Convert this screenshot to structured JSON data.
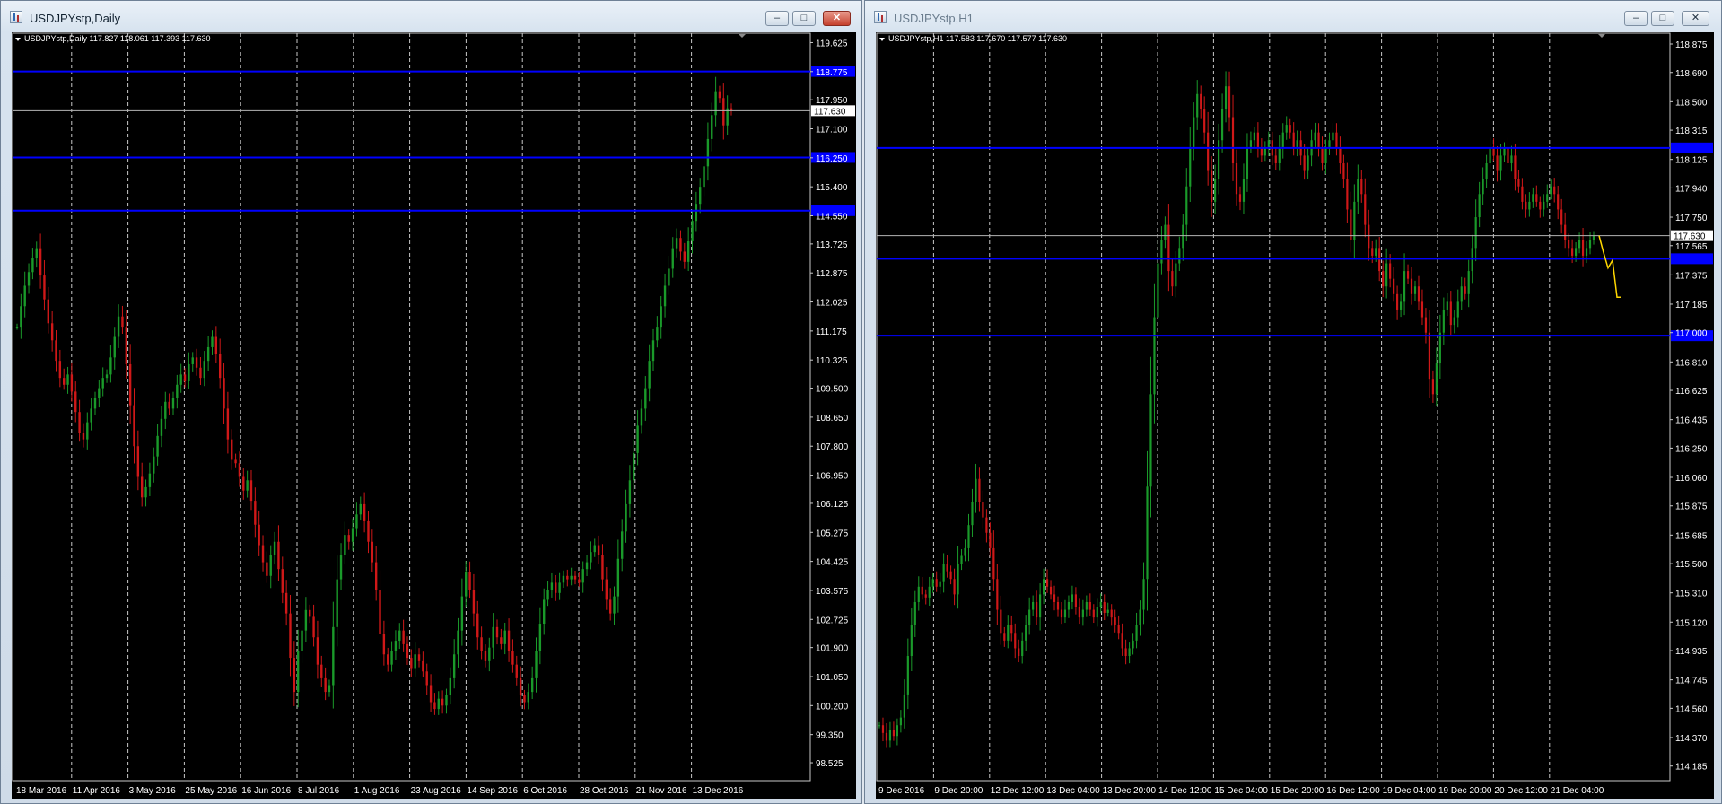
{
  "windows": [
    {
      "title": "USDJPYstp,Daily",
      "header": "USDJPYstp,Daily  117.827 118.061 117.393 117.630",
      "buttons": {
        "minimize": "–",
        "maximize": "□",
        "close": "✕"
      }
    },
    {
      "title": "USDJPYstp,H1",
      "header": "USDJPYstp,H1  117.583 117.670 117.577 117.630",
      "buttons": {
        "minimize": "–",
        "maximize": "□",
        "close": "✕"
      }
    }
  ],
  "colors": {
    "background": "#000000",
    "grid": "#c8c8c8",
    "bull": "#1a9a2a",
    "bear": "#d01818",
    "level_line": "#0000ff",
    "price_line": "#b4b4b4",
    "projection": "#ffd700"
  },
  "chart_data": [
    {
      "type": "candlestick",
      "symbol": "USDJPYstp",
      "timeframe": "Daily",
      "ohlc_last": {
        "open": 117.827,
        "high": 118.061,
        "low": 117.393,
        "close": 117.63
      },
      "ylim": [
        98.0,
        119.9
      ],
      "yticks": [
        119.625,
        118.775,
        117.95,
        117.1,
        116.25,
        115.4,
        114.55,
        113.725,
        112.875,
        112.025,
        111.175,
        110.325,
        109.5,
        108.65,
        107.8,
        106.95,
        106.125,
        105.275,
        104.425,
        103.575,
        102.725,
        101.9,
        101.05,
        100.2,
        99.35,
        98.525
      ],
      "xticks": [
        "18 Mar 2016",
        "11 Apr 2016",
        "3 May 2016",
        "25 May 2016",
        "16 Jun 2016",
        "8 Jul 2016",
        "1 Aug 2016",
        "23 Aug 2016",
        "14 Sep 2016",
        "6 Oct 2016",
        "28 Oct 2016",
        "21 Nov 2016",
        "13 Dec 2016"
      ],
      "current_price": "117.630",
      "levels": [
        118.78,
        116.26,
        114.7
      ],
      "grid": true,
      "closes": [
        111.3,
        111.9,
        112.5,
        112.9,
        113.3,
        113.6,
        112.8,
        112.1,
        111.4,
        110.9,
        110.3,
        109.8,
        109.6,
        109.9,
        109.4,
        108.8,
        108.2,
        108.0,
        108.5,
        108.9,
        109.2,
        109.5,
        109.8,
        109.9,
        110.4,
        111.0,
        111.6,
        111.3,
        110.2,
        109.0,
        107.8,
        106.9,
        106.3,
        106.6,
        107.0,
        107.5,
        108.1,
        108.6,
        109.1,
        108.9,
        109.2,
        109.6,
        109.9,
        109.7,
        110.2,
        110.4,
        110.1,
        109.8,
        110.3,
        110.7,
        111.0,
        110.5,
        109.8,
        108.9,
        108.0,
        107.4,
        107.3,
        106.9,
        106.5,
        106.8,
        106.2,
        105.5,
        104.9,
        104.4,
        104.0,
        104.6,
        105.0,
        104.2,
        103.5,
        102.9,
        101.6,
        100.6,
        101.8,
        102.4,
        103.0,
        102.8,
        102.2,
        101.4,
        101.0,
        100.6,
        100.8,
        102.5,
        103.9,
        104.6,
        105.2,
        105.0,
        105.4,
        105.8,
        106.1,
        105.6,
        105.0,
        104.4,
        103.6,
        102.3,
        101.7,
        101.4,
        101.8,
        102.1,
        102.4,
        102.0,
        101.6,
        101.3,
        101.7,
        101.5,
        101.2,
        100.8,
        100.3,
        100.1,
        100.4,
        100.2,
        100.5,
        101.0,
        101.7,
        102.4,
        103.4,
        104.1,
        103.6,
        102.9,
        102.2,
        101.8,
        101.5,
        101.9,
        102.5,
        102.2,
        102.0,
        102.4,
        101.8,
        101.4,
        101.0,
        100.5,
        100.3,
        100.6,
        101.0,
        101.8,
        102.6,
        103.3,
        103.6,
        103.8,
        103.5,
        103.8,
        104.0,
        103.9,
        104.0,
        103.9,
        103.8,
        104.2,
        104.4,
        104.7,
        104.9,
        104.6,
        103.9,
        103.3,
        102.9,
        103.4,
        104.5,
        105.3,
        106.1,
        106.8,
        107.6,
        108.4,
        108.9,
        109.5,
        110.3,
        110.9,
        111.3,
        111.9,
        112.5,
        113.0,
        113.6,
        113.9,
        113.5,
        113.2,
        113.8,
        114.4,
        114.9,
        115.4,
        116.0,
        116.8,
        117.5,
        118.2,
        118.0,
        117.2,
        117.7,
        117.63
      ]
    },
    {
      "type": "candlestick",
      "symbol": "USDJPYstp",
      "timeframe": "H1",
      "ohlc_last": {
        "open": 117.583,
        "high": 117.67,
        "low": 117.577,
        "close": 117.63
      },
      "ylim": [
        114.09,
        118.945
      ],
      "yticks": [
        118.875,
        118.69,
        118.5,
        118.315,
        118.125,
        117.94,
        117.75,
        117.565,
        117.375,
        117.185,
        117.0,
        116.81,
        116.625,
        116.435,
        116.25,
        116.06,
        115.875,
        115.685,
        115.5,
        115.31,
        115.12,
        114.935,
        114.745,
        114.56,
        114.37,
        114.185
      ],
      "xticks": [
        "9 Dec 2016",
        "9 Dec 20:00",
        "12 Dec 12:00",
        "13 Dec 04:00",
        "13 Dec 20:00",
        "14 Dec 12:00",
        "15 Dec 04:00",
        "15 Dec 20:00",
        "16 Dec 12:00",
        "19 Dec 04:00",
        "19 Dec 20:00",
        "20 Dec 12:00",
        "21 Dec 04:00"
      ],
      "current_price": "117.630",
      "levels": [
        118.2,
        117.48,
        116.98
      ],
      "grid": true,
      "projection": [
        [
          117.63,
          117.52
        ],
        [
          117.42,
          117.47
        ],
        [
          117.23,
          117.23
        ]
      ],
      "closes": [
        114.45,
        114.4,
        114.35,
        114.42,
        114.38,
        114.45,
        114.5,
        114.65,
        114.9,
        115.1,
        115.25,
        115.35,
        115.3,
        115.28,
        115.35,
        115.4,
        115.35,
        115.38,
        115.5,
        115.45,
        115.4,
        115.3,
        115.5,
        115.55,
        115.6,
        115.75,
        115.9,
        116.05,
        115.9,
        115.8,
        115.7,
        115.6,
        115.4,
        115.2,
        115.05,
        115.0,
        115.1,
        115.05,
        114.95,
        114.9,
        115.0,
        115.1,
        115.2,
        115.25,
        115.15,
        115.3,
        115.4,
        115.35,
        115.3,
        115.25,
        115.2,
        115.15,
        115.2,
        115.25,
        115.3,
        115.22,
        115.15,
        115.2,
        115.25,
        115.2,
        115.15,
        115.22,
        115.25,
        115.18,
        115.2,
        115.15,
        115.1,
        115.05,
        114.95,
        114.9,
        114.95,
        115.0,
        115.1,
        115.2,
        115.4,
        116.0,
        116.6,
        117.1,
        117.45,
        117.6,
        117.7,
        117.4,
        117.3,
        117.45,
        117.55,
        117.7,
        117.95,
        118.2,
        118.4,
        118.55,
        118.45,
        118.3,
        118.05,
        117.85,
        118.0,
        118.25,
        118.45,
        118.6,
        118.4,
        118.1,
        117.9,
        117.85,
        118.0,
        118.2,
        118.25,
        118.3,
        118.2,
        118.15,
        118.2,
        118.25,
        118.15,
        118.1,
        118.2,
        118.3,
        118.35,
        118.3,
        118.2,
        118.25,
        118.15,
        118.05,
        118.15,
        118.25,
        118.3,
        118.2,
        118.1,
        118.2,
        118.25,
        118.3,
        118.2,
        118.1,
        118.0,
        117.8,
        117.6,
        117.85,
        118.0,
        117.9,
        117.7,
        117.55,
        117.5,
        117.55,
        117.4,
        117.3,
        117.45,
        117.35,
        117.25,
        117.15,
        117.2,
        117.4,
        117.35,
        117.25,
        117.3,
        117.2,
        117.1,
        117.0,
        116.7,
        116.6,
        116.8,
        117.0,
        117.15,
        117.2,
        117.05,
        117.1,
        117.2,
        117.3,
        117.25,
        117.4,
        117.55,
        117.75,
        117.9,
        118.0,
        118.1,
        118.2,
        118.15,
        118.05,
        118.15,
        118.2,
        118.1,
        118.15,
        118.0,
        117.95,
        117.85,
        117.8,
        117.85,
        117.9,
        117.85,
        117.8,
        117.85,
        117.9,
        117.95,
        117.9,
        117.8,
        117.7,
        117.6,
        117.55,
        117.5,
        117.55,
        117.6,
        117.5,
        117.55,
        117.6,
        117.63
      ]
    }
  ]
}
